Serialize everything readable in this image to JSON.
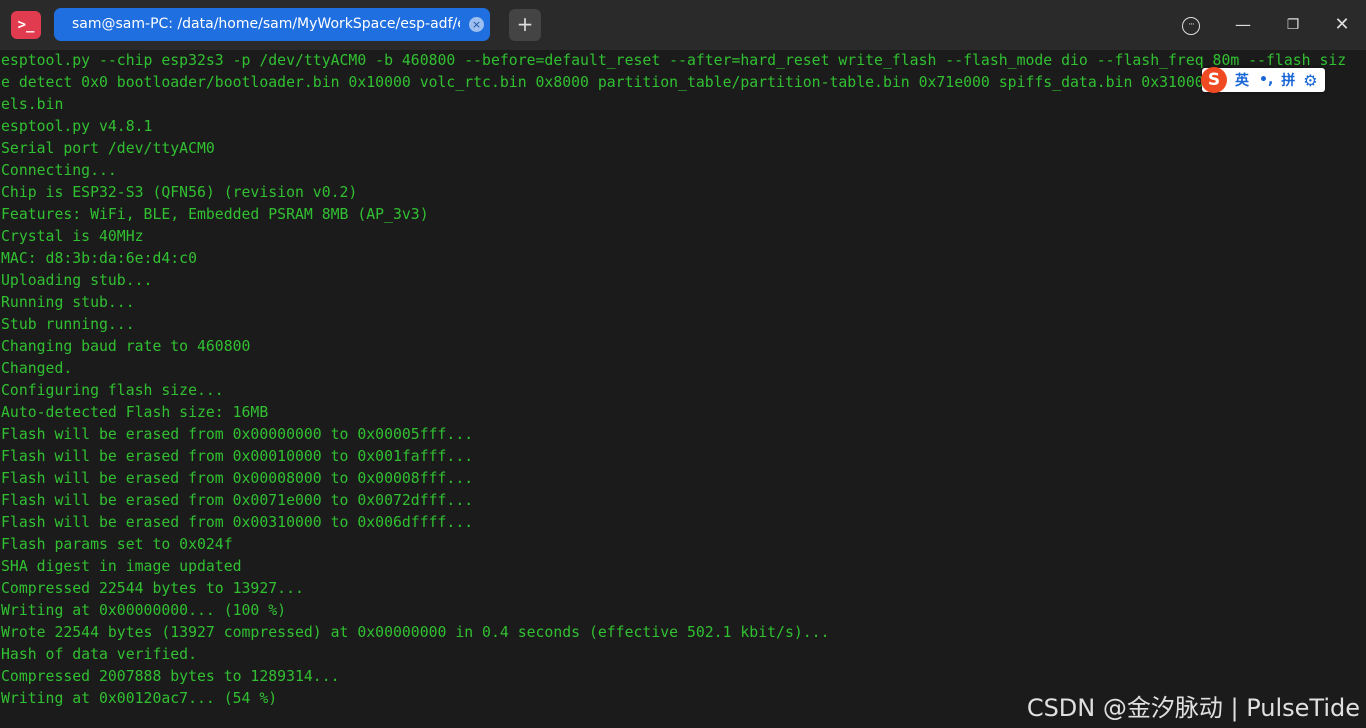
{
  "app": {
    "icon_glyph": ">_",
    "icon_color": "#e03b4e"
  },
  "tab": {
    "title": "sam@sam-PC: /data/home/sam/MyWorkSpace/esp-adf/exa···",
    "close_glyph": "×",
    "active_color": "#1f6fe0"
  },
  "titlebar": {
    "new_tab_glyph": "+",
    "more_glyph": "···",
    "minimize_glyph": "—",
    "maximize_glyph": "❐",
    "close_glyph": "✕"
  },
  "terminal": {
    "text_color": "#31c031",
    "lines": [
      "esptool.py --chip esp32s3 -p /dev/ttyACM0 -b 460800 --before=default_reset --after=hard_reset write_flash --flash_mode dio --flash_freq 80m --flash_siz",
      "e detect 0x0 bootloader/bootloader.bin 0x10000 volc_rtc.bin 0x8000 partition_table/partition-table.bin 0x71e000 spiffs_data.bin 0x310000 srmod",
      "els.bin",
      "esptool.py v4.8.1",
      "Serial port /dev/ttyACM0",
      "Connecting...",
      "Chip is ESP32-S3 (QFN56) (revision v0.2)",
      "Features: WiFi, BLE, Embedded PSRAM 8MB (AP_3v3)",
      "Crystal is 40MHz",
      "MAC: d8:3b:da:6e:d4:c0",
      "Uploading stub...",
      "Running stub...",
      "Stub running...",
      "Changing baud rate to 460800",
      "Changed.",
      "Configuring flash size...",
      "Auto-detected Flash size: 16MB",
      "Flash will be erased from 0x00000000 to 0x00005fff...",
      "Flash will be erased from 0x00010000 to 0x001fafff...",
      "Flash will be erased from 0x00008000 to 0x00008fff...",
      "Flash will be erased from 0x0071e000 to 0x0072dfff...",
      "Flash will be erased from 0x00310000 to 0x006dffff...",
      "Flash params set to 0x024f",
      "SHA digest in image updated",
      "Compressed 22544 bytes to 13927...",
      "Writing at 0x00000000... (100 %)",
      "Wrote 22544 bytes (13927 compressed) at 0x00000000 in 0.4 seconds (effective 502.1 kbit/s)...",
      "Hash of data verified.",
      "Compressed 2007888 bytes to 1289314...",
      "Writing at 0x00120ac7... (54 %)"
    ]
  },
  "ime": {
    "logo": "S",
    "mode": "英",
    "punct": "•,",
    "layout": "拼",
    "settings_glyph": "⚙",
    "logo_color": "#f04a22",
    "accent": "#1866d6"
  },
  "watermark": {
    "text": "CSDN @金汐脉动 | PulseTide"
  }
}
